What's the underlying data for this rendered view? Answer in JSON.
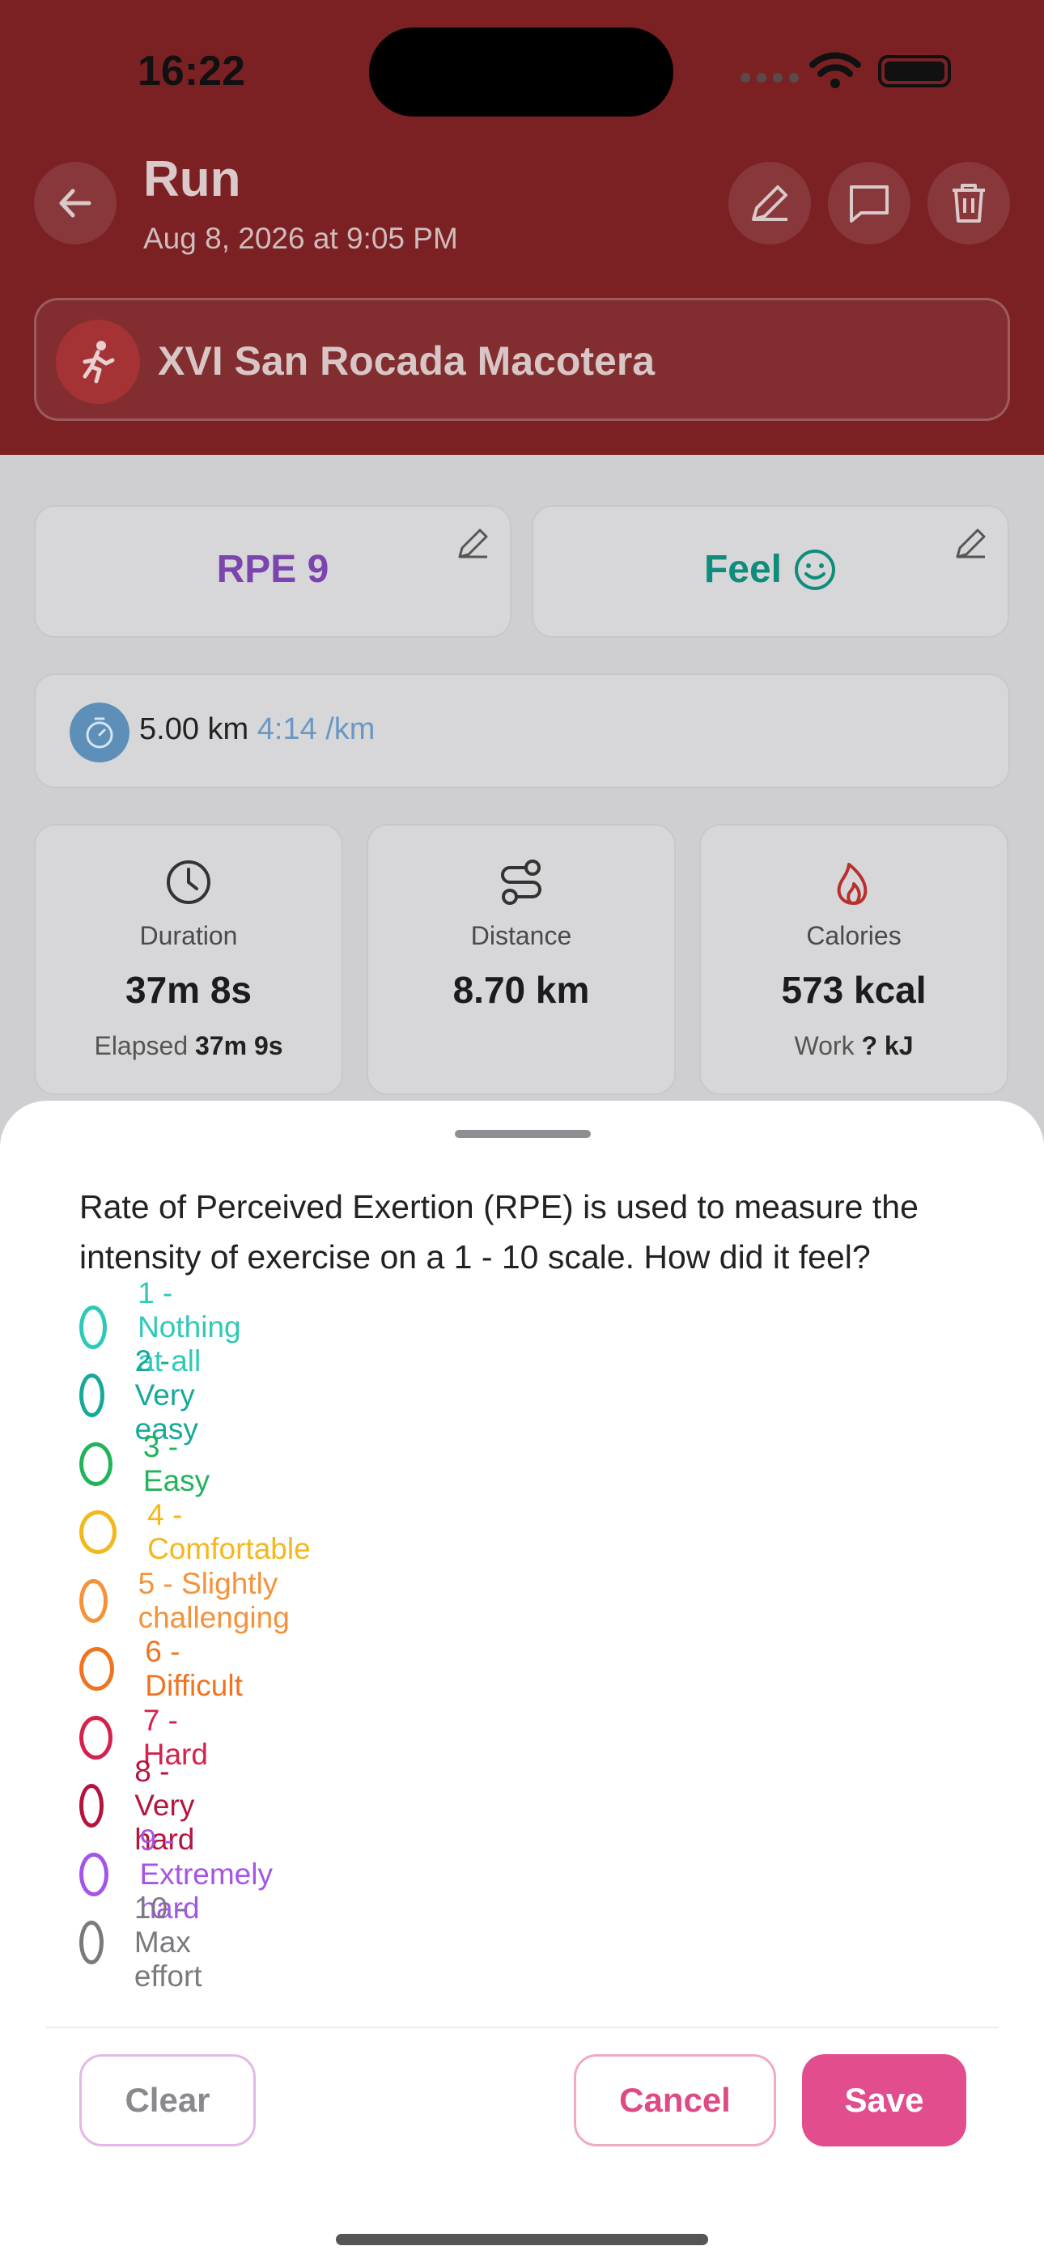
{
  "status_bar": {
    "time": "16:22"
  },
  "header": {
    "title": "Run",
    "subtitle": "Aug 8, 2026 at 9:05 PM",
    "event_name": "XVI San Rocada Macotera"
  },
  "cards": {
    "rpe_label": "RPE 9",
    "feel_label": "Feel"
  },
  "pace": {
    "distance": "5.00 km",
    "pace": "4:14 /km"
  },
  "stats": [
    {
      "label": "Duration",
      "value": "37m 8s",
      "sub_label": "Elapsed",
      "sub_value": "37m 9s"
    },
    {
      "label": "Distance",
      "value": "8.70 km"
    },
    {
      "label": "Calories",
      "value": "573 kcal",
      "sub_label": "Work",
      "sub_value": "? kJ"
    }
  ],
  "sheet": {
    "question": "Rate of Perceived Exertion (RPE) is used to measure the intensity of exercise on a 1 - 10 scale. How did it feel?",
    "options": [
      {
        "label": "1 - Nothing at all",
        "color": "#2ec9b8"
      },
      {
        "label": "2 - Very easy",
        "color": "#16a99a"
      },
      {
        "label": "3 - Easy",
        "color": "#22b45a"
      },
      {
        "label": "4 - Comfortable",
        "color": "#f2b81e"
      },
      {
        "label": "5 - Slightly challenging",
        "color": "#f6923a"
      },
      {
        "label": "6 - Difficult",
        "color": "#ee7420"
      },
      {
        "label": "7 - Hard",
        "color": "#d6204d"
      },
      {
        "label": "8 - Very hard",
        "color": "#b5143c"
      },
      {
        "label": "9 - Extremely hard",
        "color": "#a555e6"
      },
      {
        "label": "10 - Max effort",
        "color": "#7a7a7e"
      }
    ],
    "clear_label": "Clear",
    "cancel_label": "Cancel",
    "save_label": "Save"
  }
}
